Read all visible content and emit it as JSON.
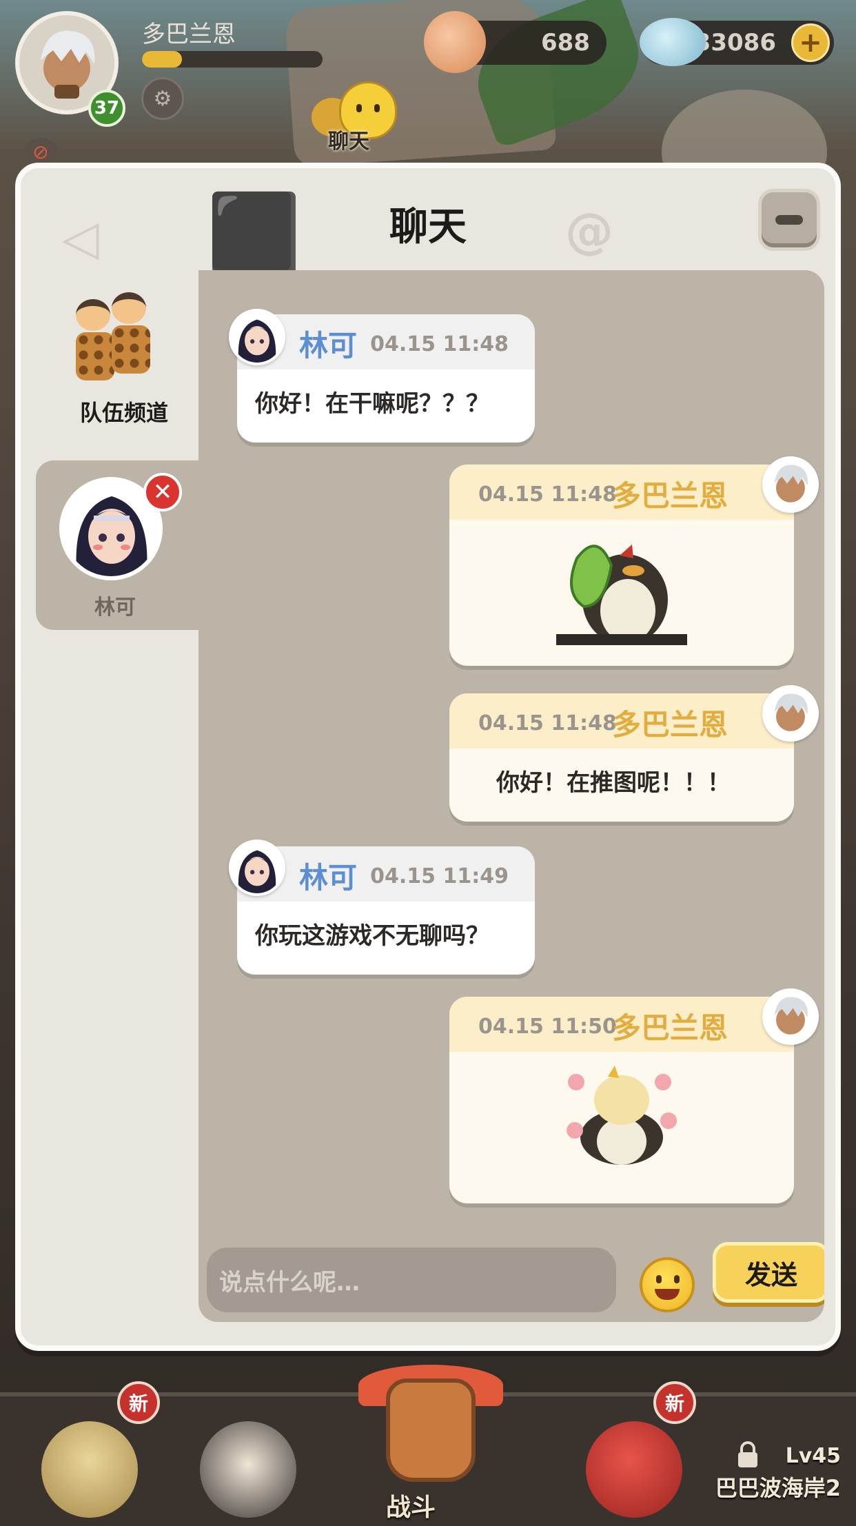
{
  "hud": {
    "player_name": "多巴兰恩",
    "level": "37",
    "exp_fraction": 0.22,
    "shells": "688",
    "pearls": "233086",
    "add_label": "+",
    "chat_shortcut_label": "聊天"
  },
  "panel": {
    "title": "聊天"
  },
  "channels": {
    "team": {
      "label": "队伍频道"
    },
    "private": {
      "label": "林可",
      "close_label": "✕"
    }
  },
  "messages": [
    {
      "direction": "in",
      "sender": "林可",
      "time": "04.15 11:48",
      "text": "你好！在干嘛呢？？？"
    },
    {
      "direction": "out",
      "sender": "多巴兰恩",
      "time": "04.15 11:48",
      "sticker": "penguin-with-leaf"
    },
    {
      "direction": "out",
      "sender": "多巴兰恩",
      "time": "04.15 11:48",
      "text": "你好！在推图呢！！！"
    },
    {
      "direction": "in",
      "sender": "林可",
      "time": "04.15 11:49",
      "text": "你玩这游戏不无聊吗？"
    },
    {
      "direction": "out",
      "sender": "多巴兰恩",
      "time": "04.15 11:50",
      "sticker": "penguin-with-flowers"
    }
  ],
  "input": {
    "placeholder": "说点什么呢…",
    "send_label": "发送"
  },
  "bottom_nav": {
    "badge_new": "新",
    "battle_label": "战斗",
    "locked_level": "Lv45",
    "locked_area": "巴巴波海岸2"
  },
  "colors": {
    "incoming_name": "#5c8fd1",
    "outgoing_name": "#e2ad3e",
    "send_button": "#f6d25a",
    "close_badge": "#d93430"
  }
}
